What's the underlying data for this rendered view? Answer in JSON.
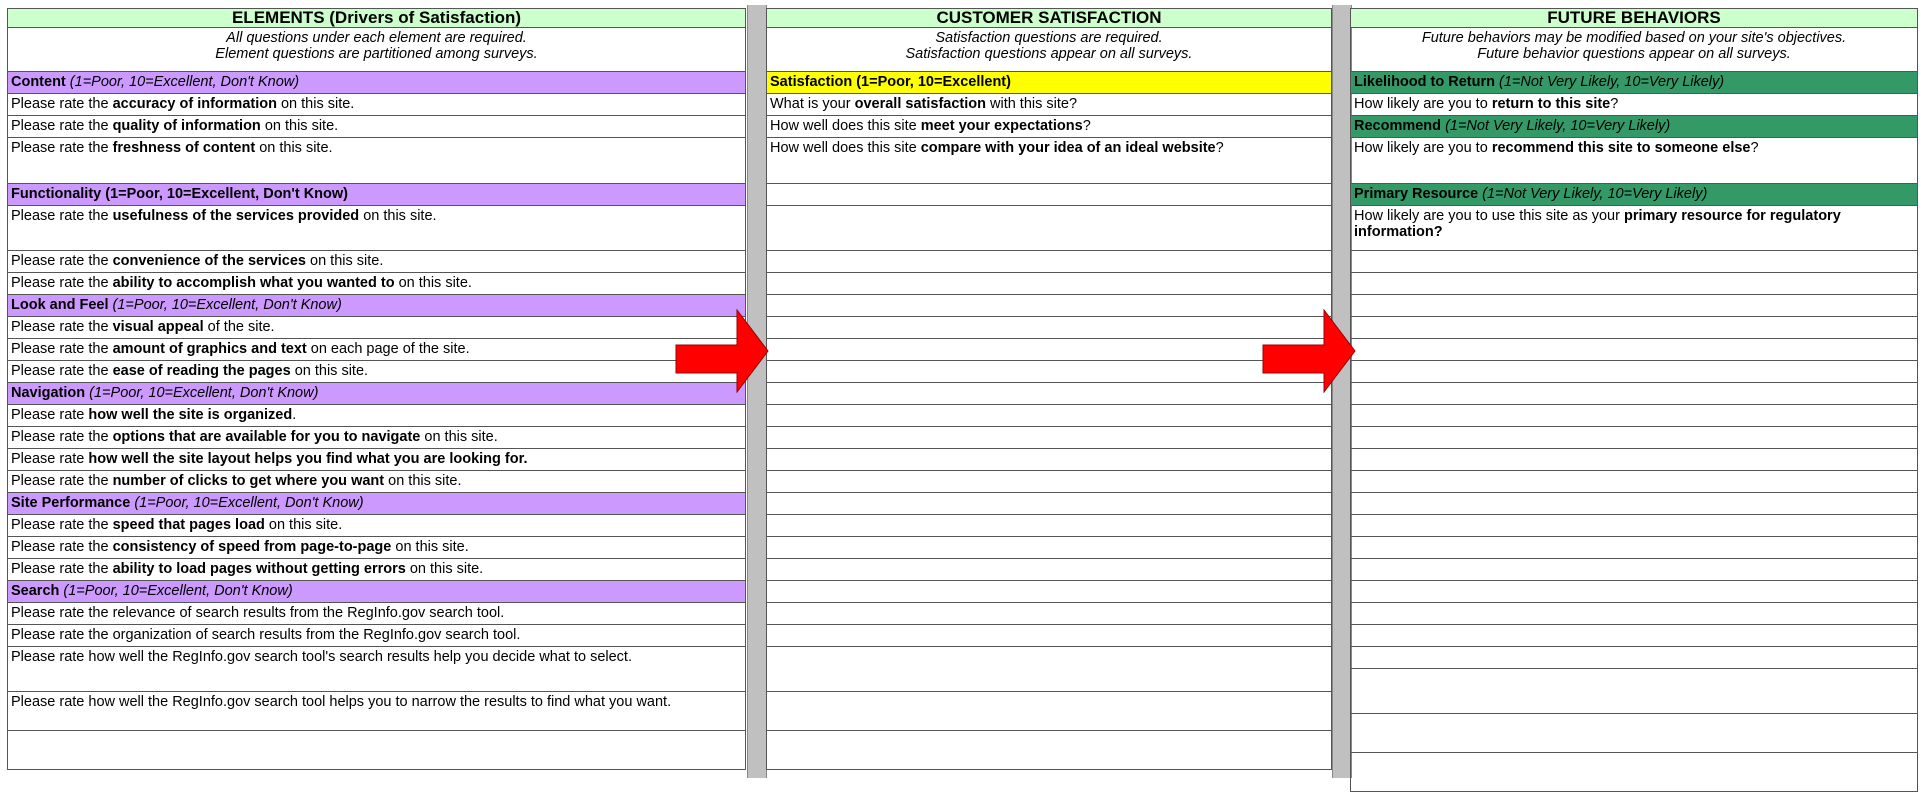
{
  "col1": {
    "header": "ELEMENTS (Drivers of Satisfaction)",
    "note1": "All questions under each element are required.",
    "note2": "Element questions are partitioned among surveys.",
    "sections": [
      {
        "title": "Content",
        "scale": "(1=Poor, 10=Excellent, Don't Know)",
        "q": [
          {
            "a": "Please rate the ",
            "b": "accuracy of information",
            "c": " on this site."
          },
          {
            "a": "Please rate the ",
            "b": "quality of information",
            "c": " on this site."
          },
          {
            "a": "Please rate the ",
            "b": "freshness of content",
            "c": " on this site."
          }
        ]
      },
      {
        "title": "Functionality (1=Poor, 10=Excellent, Don't Know)",
        "q": [
          {
            "a": "Please rate the ",
            "b": "usefulness of the services provided",
            "c": " on this site."
          },
          {
            "a": "Please rate the ",
            "b": "convenience of the services",
            "c": " on this site."
          },
          {
            "a": "Please rate the ",
            "b": "ability to accomplish what you wanted to",
            "c": " on this site."
          }
        ]
      },
      {
        "title": "Look and Feel",
        "scale": "(1=Poor, 10=Excellent, Don't Know)",
        "q": [
          {
            "a": "Please rate the ",
            "b": "visual appeal",
            "c": " of the site."
          },
          {
            "a": "Please rate the ",
            "b": "amount of graphics and text",
            "c": " on each page of the site."
          },
          {
            "a": "Please rate the ",
            "b": "ease of reading the pages",
            "c": " on this site."
          }
        ]
      },
      {
        "title": "Navigation",
        "scale": "(1=Poor, 10=Excellent, Don't Know)",
        "q": [
          {
            "a": "Please rate ",
            "b": "how well the site is organized",
            "c": "."
          },
          {
            "a": "Please rate the ",
            "b": "options that are available for you to navigate",
            "c": " on this site."
          },
          {
            "a": "Please rate ",
            "b": "how well the site layout helps you find what you are looking for.",
            "c": ""
          },
          {
            "a": "Please rate the ",
            "b": "number of clicks to get where you want",
            "c": " on this site."
          }
        ]
      },
      {
        "title": "Site Performance",
        "scale": "(1=Poor, 10=Excellent, Don't Know)",
        "q": [
          {
            "a": "Please rate the ",
            "b": "speed that pages load",
            "c": " on this site."
          },
          {
            "a": "Please rate the ",
            "b": "consistency of speed from page-to-page",
            "c": " on this site."
          },
          {
            "a": "Please rate the ",
            "b": "ability to load pages without getting errors",
            "c": " on this site."
          }
        ]
      },
      {
        "title": "Search",
        "scale": "(1=Poor, 10=Excellent, Don't Know)",
        "q": [
          "Please rate the relevance of search results from the RegInfo.gov search tool.",
          "Please rate the organization of search results from the RegInfo.gov search tool.",
          "Please rate how well the RegInfo.gov search tool's search results help you decide what to select.",
          "Please rate how well the RegInfo.gov search tool helps you to narrow the results to find what you want."
        ]
      }
    ]
  },
  "col2": {
    "header": "CUSTOMER SATISFACTION",
    "note1": "Satisfaction questions are required.",
    "note2": "Satisfaction questions appear on all surveys.",
    "section": "Satisfaction (1=Poor, 10=Excellent)",
    "q": [
      {
        "a": "What is your ",
        "b": "overall satisfaction",
        "c": " with this site?"
      },
      {
        "a": "How well does this site ",
        "b": "meet your expectations",
        "c": "?"
      },
      {
        "a": "How well does this site ",
        "b": "compare with your idea of an ideal website",
        "c": "?"
      }
    ]
  },
  "col3": {
    "header": "FUTURE BEHAVIORS",
    "note1": "Future behaviors may be modified based on your site's objectives.",
    "note2": "Future behavior questions appear on all surveys.",
    "sections": [
      {
        "title": "Likelihood to Return",
        "scale": "(1=Not Very Likely, 10=Very Likely)",
        "q": {
          "a": "How likely are you to ",
          "b": "return to this site",
          "c": "?"
        }
      },
      {
        "title": "Recommend",
        "scale": "(1=Not Very Likely, 10=Very Likely)",
        "q": {
          "a": "How likely are you to ",
          "b": "recommend this site to someone else",
          "c": "?"
        }
      },
      {
        "title": "Primary Resource",
        "scale": "(1=Not Very Likely, 10=Very Likely)",
        "q": {
          "a": "How likely are you to use this site as your ",
          "b": "primary resource for regulatory information?"
        }
      }
    ]
  },
  "colors": {
    "header_bg": "#ccffcc",
    "element_section": "#cc99ff",
    "satisfaction_section": "#ffff00",
    "behavior_section": "#339966",
    "arrow": "#ff0000",
    "separator": "#c0c0c0"
  },
  "icons": [
    "right-arrow-icon"
  ]
}
